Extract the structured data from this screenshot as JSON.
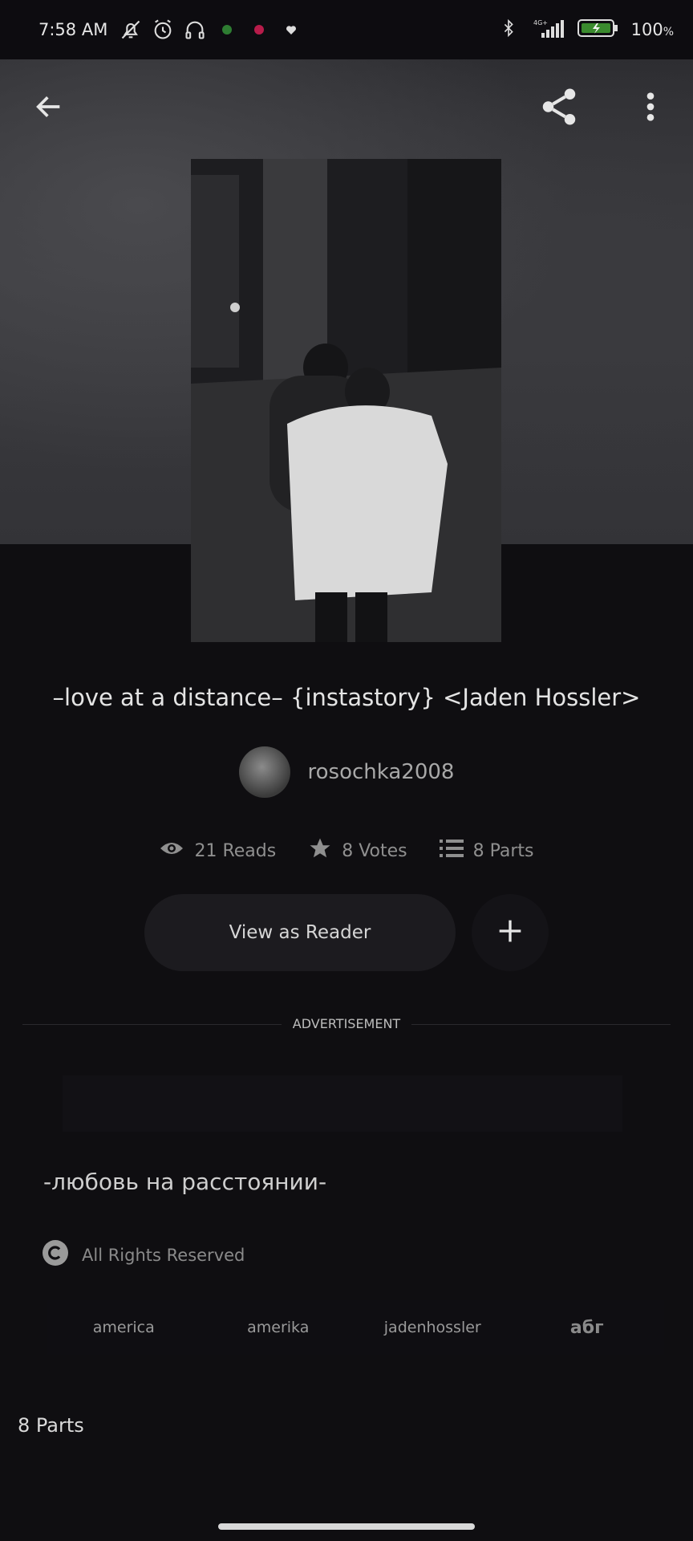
{
  "status_bar": {
    "time": "7:58 AM",
    "network": "4G+",
    "battery_pct": "100",
    "battery_suffix": "%"
  },
  "header": {
    "back_icon": "arrow-left-icon",
    "share_icon": "share-icon",
    "more_icon": "more-vertical-icon"
  },
  "story": {
    "title": "–love at a distance– {instastory} <Jaden Hossler>",
    "author": "rosochka2008",
    "reads": "21 Reads",
    "votes": "8 Votes",
    "parts": "8 Parts"
  },
  "actions": {
    "view_as_reader": "View as Reader",
    "add_icon": "plus-icon"
  },
  "ad": {
    "label": "ADVERTISEMENT"
  },
  "description": "-любовь на расстоянии-",
  "license": "All Rights Reserved",
  "tags": [
    "america",
    "amerika",
    "jadenhossler",
    "абг"
  ],
  "parts_heading": "8 Parts",
  "colors": {
    "background": "#0f0e11",
    "text": "#d9d9d9",
    "muted": "#8f8f8f"
  }
}
